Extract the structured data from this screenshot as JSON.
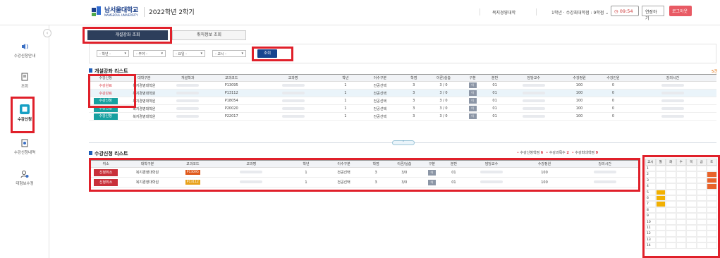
{
  "header": {
    "logo_text": "남서울대학교",
    "logo_sub": "NAMSEOUL UNIVERSITY",
    "semester": "2022학년 2학기",
    "college": "복지경영대학",
    "grade_info": "1학년 · 수강최대학점 : 9학점 ⌄",
    "timer": "09:54",
    "extend_label": "연장하기",
    "logout_label": "로그아웃"
  },
  "sidebar": {
    "items": [
      {
        "label": "수강신청안내",
        "icon": "speaker-icon"
      },
      {
        "label": "조회",
        "icon": "document-icon"
      },
      {
        "label": "수강신청",
        "icon": "apply-icon"
      },
      {
        "label": "수강신청내역",
        "icon": "history-icon"
      },
      {
        "label": "대형보수정",
        "icon": "users-icon"
      }
    ]
  },
  "tabs": [
    {
      "label": "개설강좌 조회"
    },
    {
      "label": "취직정보 조회"
    }
  ],
  "filters": {
    "grade": "- 학년 -",
    "major": "- 주야 -",
    "day": "- 요일 -",
    "period": "- 교시 -",
    "search_label": "조회"
  },
  "course_list": {
    "title": "개설강좌 리스트",
    "count": "5건",
    "headers": [
      "수강신청",
      "대학구분",
      "개설학과",
      "교과코드",
      "교과명",
      "학년",
      "이수구분",
      "학점",
      "이론/실습",
      "구분",
      "분반",
      "담당교수",
      "수강정원",
      "수강인원",
      "강의시간"
    ],
    "rows": [
      {
        "status": "수강완료",
        "college": "복지경영대학원",
        "code": "P13095",
        "grade": "1",
        "type": "전공선택",
        "credit": "3",
        "theory": "3 / 0",
        "kind": "이",
        "section": "01",
        "capacity": "100",
        "enrolled": "0"
      },
      {
        "status": "수강완료",
        "college": "복지경영대학원",
        "code": "P13112",
        "grade": "1",
        "type": "전공선택",
        "credit": "3",
        "theory": "3 / 0",
        "kind": "이",
        "section": "01",
        "capacity": "100",
        "enrolled": "0"
      },
      {
        "status": "수강신청",
        "college": "복지경영대학원",
        "code": "P18054",
        "grade": "1",
        "type": "전공선택",
        "credit": "3",
        "theory": "3 / 0",
        "kind": "이",
        "section": "01",
        "capacity": "100",
        "enrolled": "0"
      },
      {
        "status": "수강신청",
        "college": "복지경영대학원",
        "code": "P20020",
        "grade": "1",
        "type": "전공선택",
        "credit": "3",
        "theory": "3 / 0",
        "kind": "이",
        "section": "01",
        "capacity": "100",
        "enrolled": "0"
      },
      {
        "status": "수강신청",
        "college": "복지경영대학원",
        "code": "P22017",
        "grade": "1",
        "type": "전공선택",
        "credit": "3",
        "theory": "3 / 0",
        "kind": "이",
        "section": "01",
        "capacity": "100",
        "enrolled": "0"
      }
    ]
  },
  "apply_list": {
    "title": "수강신청 리스트",
    "legend": [
      {
        "label": "수강신청학점",
        "value": "6"
      },
      {
        "label": "수강과목수",
        "value": "2"
      },
      {
        "label": "수강최대학점",
        "value": "9"
      }
    ],
    "headers": [
      "취소",
      "대학구분",
      "교과코드",
      "교과명",
      "학년",
      "이수구분",
      "학점",
      "이론/실습",
      "구분",
      "분반",
      "담당교수",
      "수강정원",
      "강의시간"
    ],
    "rows": [
      {
        "action": "신청취소",
        "college": "복지경영대학원",
        "code": "P13095",
        "grade": "1",
        "type": "전공선택",
        "credit": "3",
        "theory": "3/0",
        "kind": "이",
        "section": "01",
        "capacity": "100"
      },
      {
        "action": "신청취소",
        "college": "복지경영대학원",
        "code": "P13112",
        "grade": "1",
        "type": "전공선택",
        "credit": "3",
        "theory": "3/0",
        "kind": "이",
        "section": "01",
        "capacity": "100"
      }
    ]
  },
  "timetable": {
    "corner": "교시",
    "days": [
      "월",
      "화",
      "수",
      "목",
      "금",
      "토"
    ],
    "periods": [
      "1",
      "2",
      "3",
      "4",
      "5",
      "6",
      "7",
      "8",
      "9",
      "10",
      "11",
      "12",
      "13",
      "14"
    ]
  }
}
